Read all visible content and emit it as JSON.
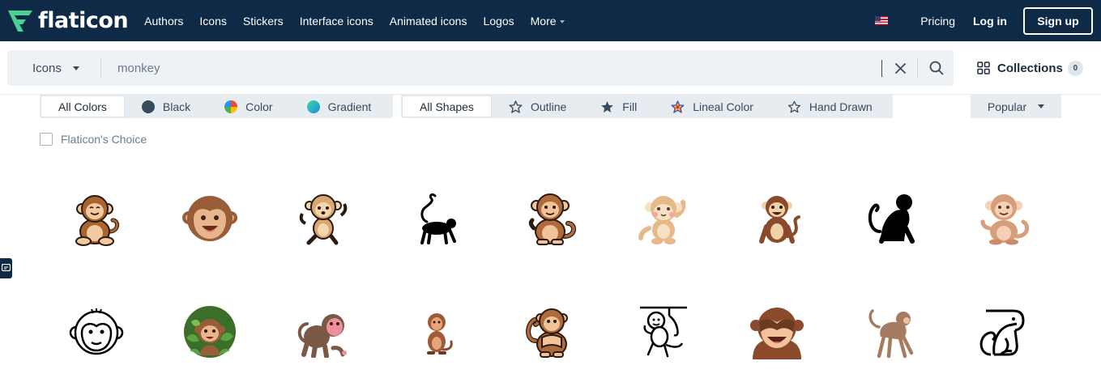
{
  "brand": {
    "name": "flaticon",
    "accent": "#4ad295",
    "nav_bg": "#0e2a47"
  },
  "nav": {
    "links": [
      {
        "label": "Authors"
      },
      {
        "label": "Icons"
      },
      {
        "label": "Stickers"
      },
      {
        "label": "Interface icons"
      },
      {
        "label": "Animated icons"
      },
      {
        "label": "Logos"
      },
      {
        "label": "More"
      }
    ],
    "flag_icon": "us-flag-icon",
    "pricing": "Pricing",
    "login": "Log in",
    "signup": "Sign up"
  },
  "search": {
    "type_selected": "Icons",
    "query": "monkey",
    "clear_icon": "close-icon",
    "search_icon": "search-icon"
  },
  "collections": {
    "label": "Collections",
    "count": "0"
  },
  "filters": {
    "colors": [
      "All Colors",
      "Black",
      "Color",
      "Gradient"
    ],
    "color_swatches": {
      "black": "#374a5e",
      "gradient_a": "#3ddc97",
      "gradient_b": "#1e88e5"
    },
    "shapes": [
      "All Shapes",
      "Outline",
      "Fill",
      "Lineal Color",
      "Hand Drawn"
    ],
    "sort": "Popular",
    "flaticon_choice": "Flaticon's Choice"
  },
  "results": [
    {
      "style": "lineal-color",
      "name": "sitting-monkey-icon"
    },
    {
      "style": "flat",
      "name": "monkey-face-icon"
    },
    {
      "style": "lineal-color",
      "name": "dancing-monkey-icon"
    },
    {
      "style": "glyph",
      "name": "walking-monkey-silhouette-icon"
    },
    {
      "style": "lineal-color",
      "name": "sitting-monkey-icon"
    },
    {
      "style": "flat",
      "name": "waving-monkey-icon"
    },
    {
      "style": "flat",
      "name": "sitting-monkey-icon"
    },
    {
      "style": "glyph",
      "name": "sitting-monkey-silhouette-icon"
    },
    {
      "style": "flat",
      "name": "sitting-monkey-icon"
    },
    {
      "style": "outline",
      "name": "monkey-face-outline-icon"
    },
    {
      "style": "flat",
      "name": "monkey-jungle-icon"
    },
    {
      "style": "flat",
      "name": "macaque-icon"
    },
    {
      "style": "flat",
      "name": "small-monkey-icon"
    },
    {
      "style": "lineal-color",
      "name": "hiding-monkey-icon"
    },
    {
      "style": "outline",
      "name": "hanging-monkey-icon"
    },
    {
      "style": "flat",
      "name": "see-no-evil-monkey-icon"
    },
    {
      "style": "flat",
      "name": "walking-monkey-icon"
    },
    {
      "style": "outline",
      "name": "sitting-monkey-outline-icon"
    }
  ]
}
